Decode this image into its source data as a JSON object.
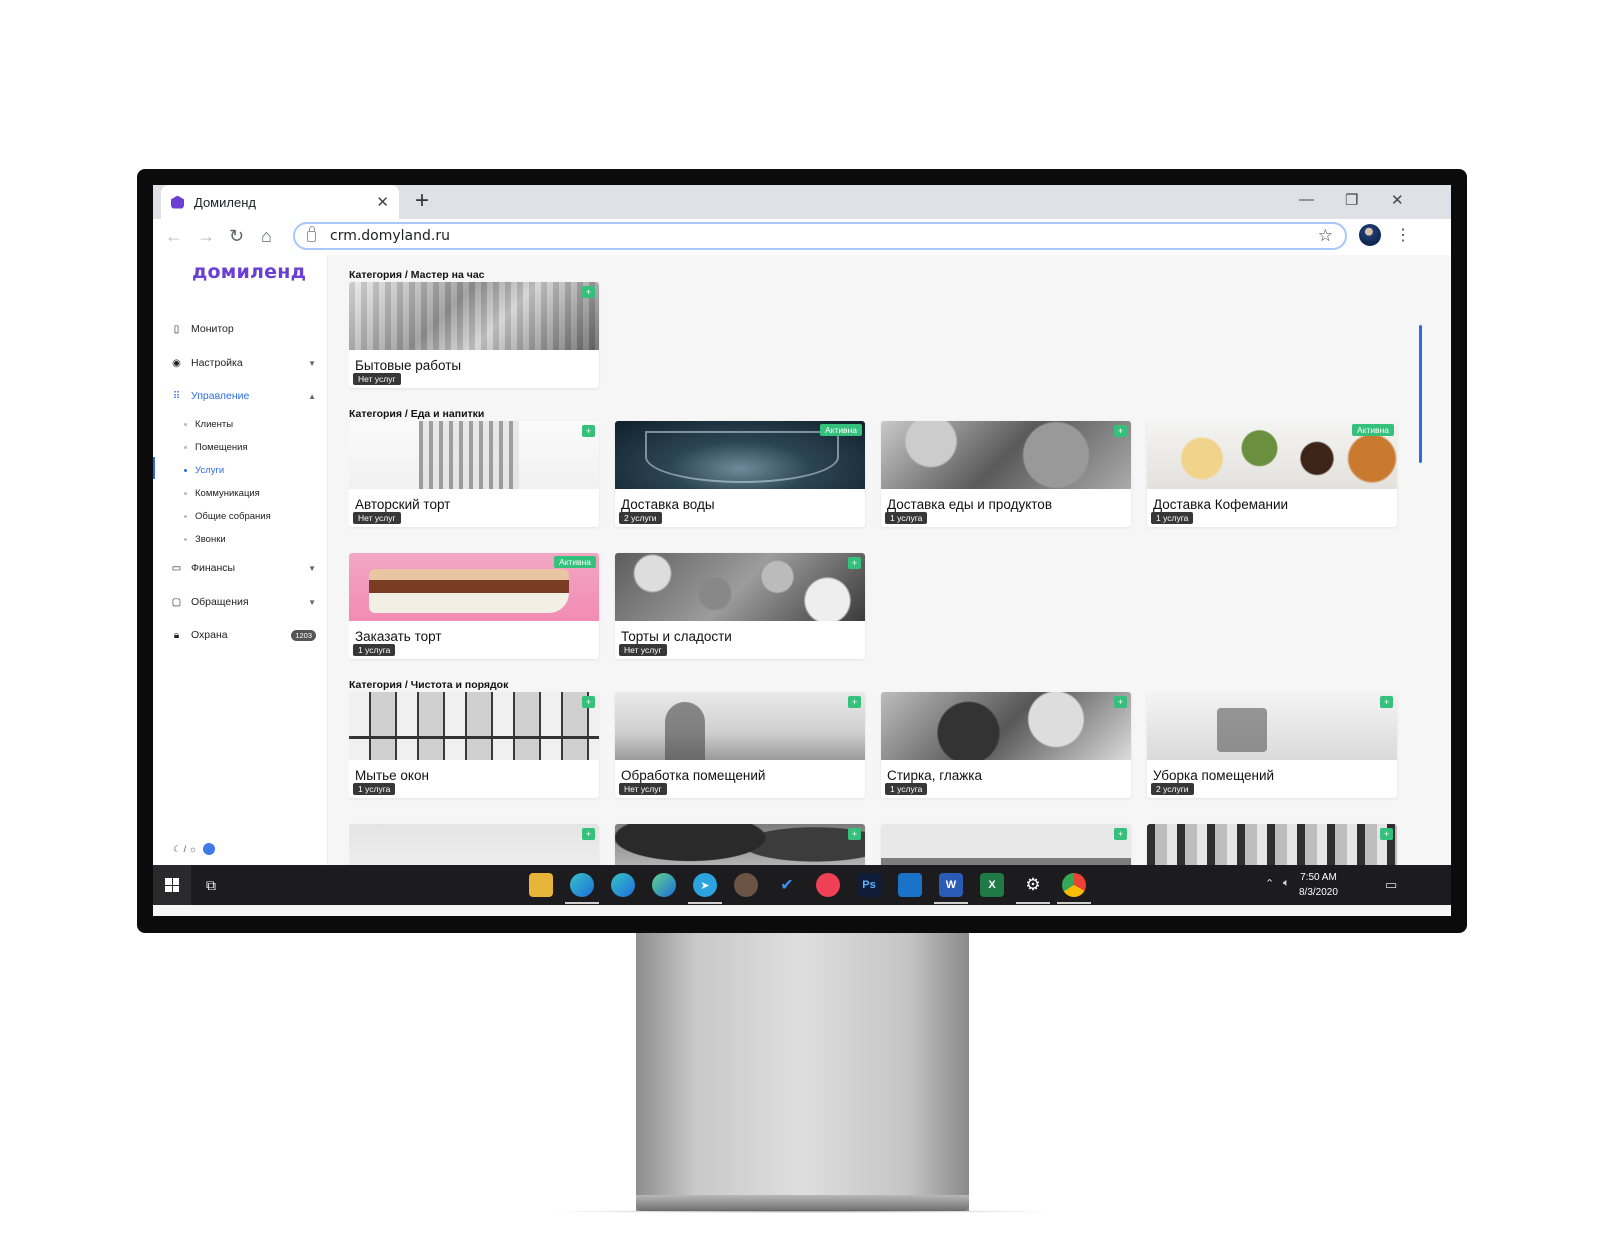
{
  "browser": {
    "tab_title": "Домиленд",
    "url": "crm.domyland.ru",
    "icons": {
      "back": "arrow-left-icon",
      "forward": "arrow-right-icon",
      "reload": "reload-icon",
      "home": "home-icon",
      "star": "star-icon"
    }
  },
  "sidebar": {
    "logo": "домиленд",
    "items": {
      "monitor": "Монитор",
      "settings": "Настройка",
      "management": "Управление",
      "finances": "Финансы",
      "requests": "Обращения",
      "security": "Охрана"
    },
    "sub": {
      "clients": "Клиенты",
      "premises": "Помещения",
      "services": "Услуги",
      "communication": "Коммуникация",
      "meetings": "Общие собрания",
      "calls": "Звонки"
    },
    "security_badge": "1203",
    "theme_toggle": "☾ / ☼"
  },
  "categories": [
    {
      "title": "Категория / Мастер на час",
      "cards": [
        {
          "title": "Бытовые работы",
          "count": "Нет услуг",
          "status": ""
        }
      ]
    },
    {
      "title": "Категория / Еда и напитки",
      "cards": [
        {
          "title": "Авторский торт",
          "count": "Нет услуг",
          "status": ""
        },
        {
          "title": "Доставка воды",
          "count": "2 услуги",
          "status": "Активна"
        },
        {
          "title": "Доставка еды и продуктов",
          "count": "1 услуга",
          "status": ""
        },
        {
          "title": "Доставка Кофемании",
          "count": "1 услуга",
          "status": "Активна"
        },
        {
          "title": "Заказать торт",
          "count": "1 услуга",
          "status": "Активна"
        },
        {
          "title": "Торты и сладости",
          "count": "Нет услуг",
          "status": ""
        }
      ]
    },
    {
      "title": "Категория / Чистота и порядок",
      "cards": [
        {
          "title": "Мытье окон",
          "count": "1 услуга",
          "status": ""
        },
        {
          "title": "Обработка помещений",
          "count": "Нет услуг",
          "status": ""
        },
        {
          "title": "Стирка, глажка",
          "count": "1 услуга",
          "status": ""
        },
        {
          "title": "Уборка помещений",
          "count": "2 услуги",
          "status": ""
        }
      ]
    }
  ],
  "add_label": "+",
  "taskbar": {
    "time": "7:50 AM",
    "date": "8/3/2020",
    "apps": [
      "file-explorer-icon",
      "edge-icon",
      "edge-beta-icon",
      "edge-dev-icon",
      "telegram-icon",
      "app-icon",
      "todo-icon",
      "pocket-icon",
      "photoshop-icon",
      "outlook-icon",
      "word-icon",
      "excel-icon",
      "settings-icon",
      "chrome-icon"
    ],
    "app_labels": {
      "ps": "Ps",
      "word": "W",
      "excel": "X"
    }
  },
  "colors": {
    "brand": "#6b3fd6",
    "accent": "#2f6ce0",
    "success": "#34c17c"
  }
}
